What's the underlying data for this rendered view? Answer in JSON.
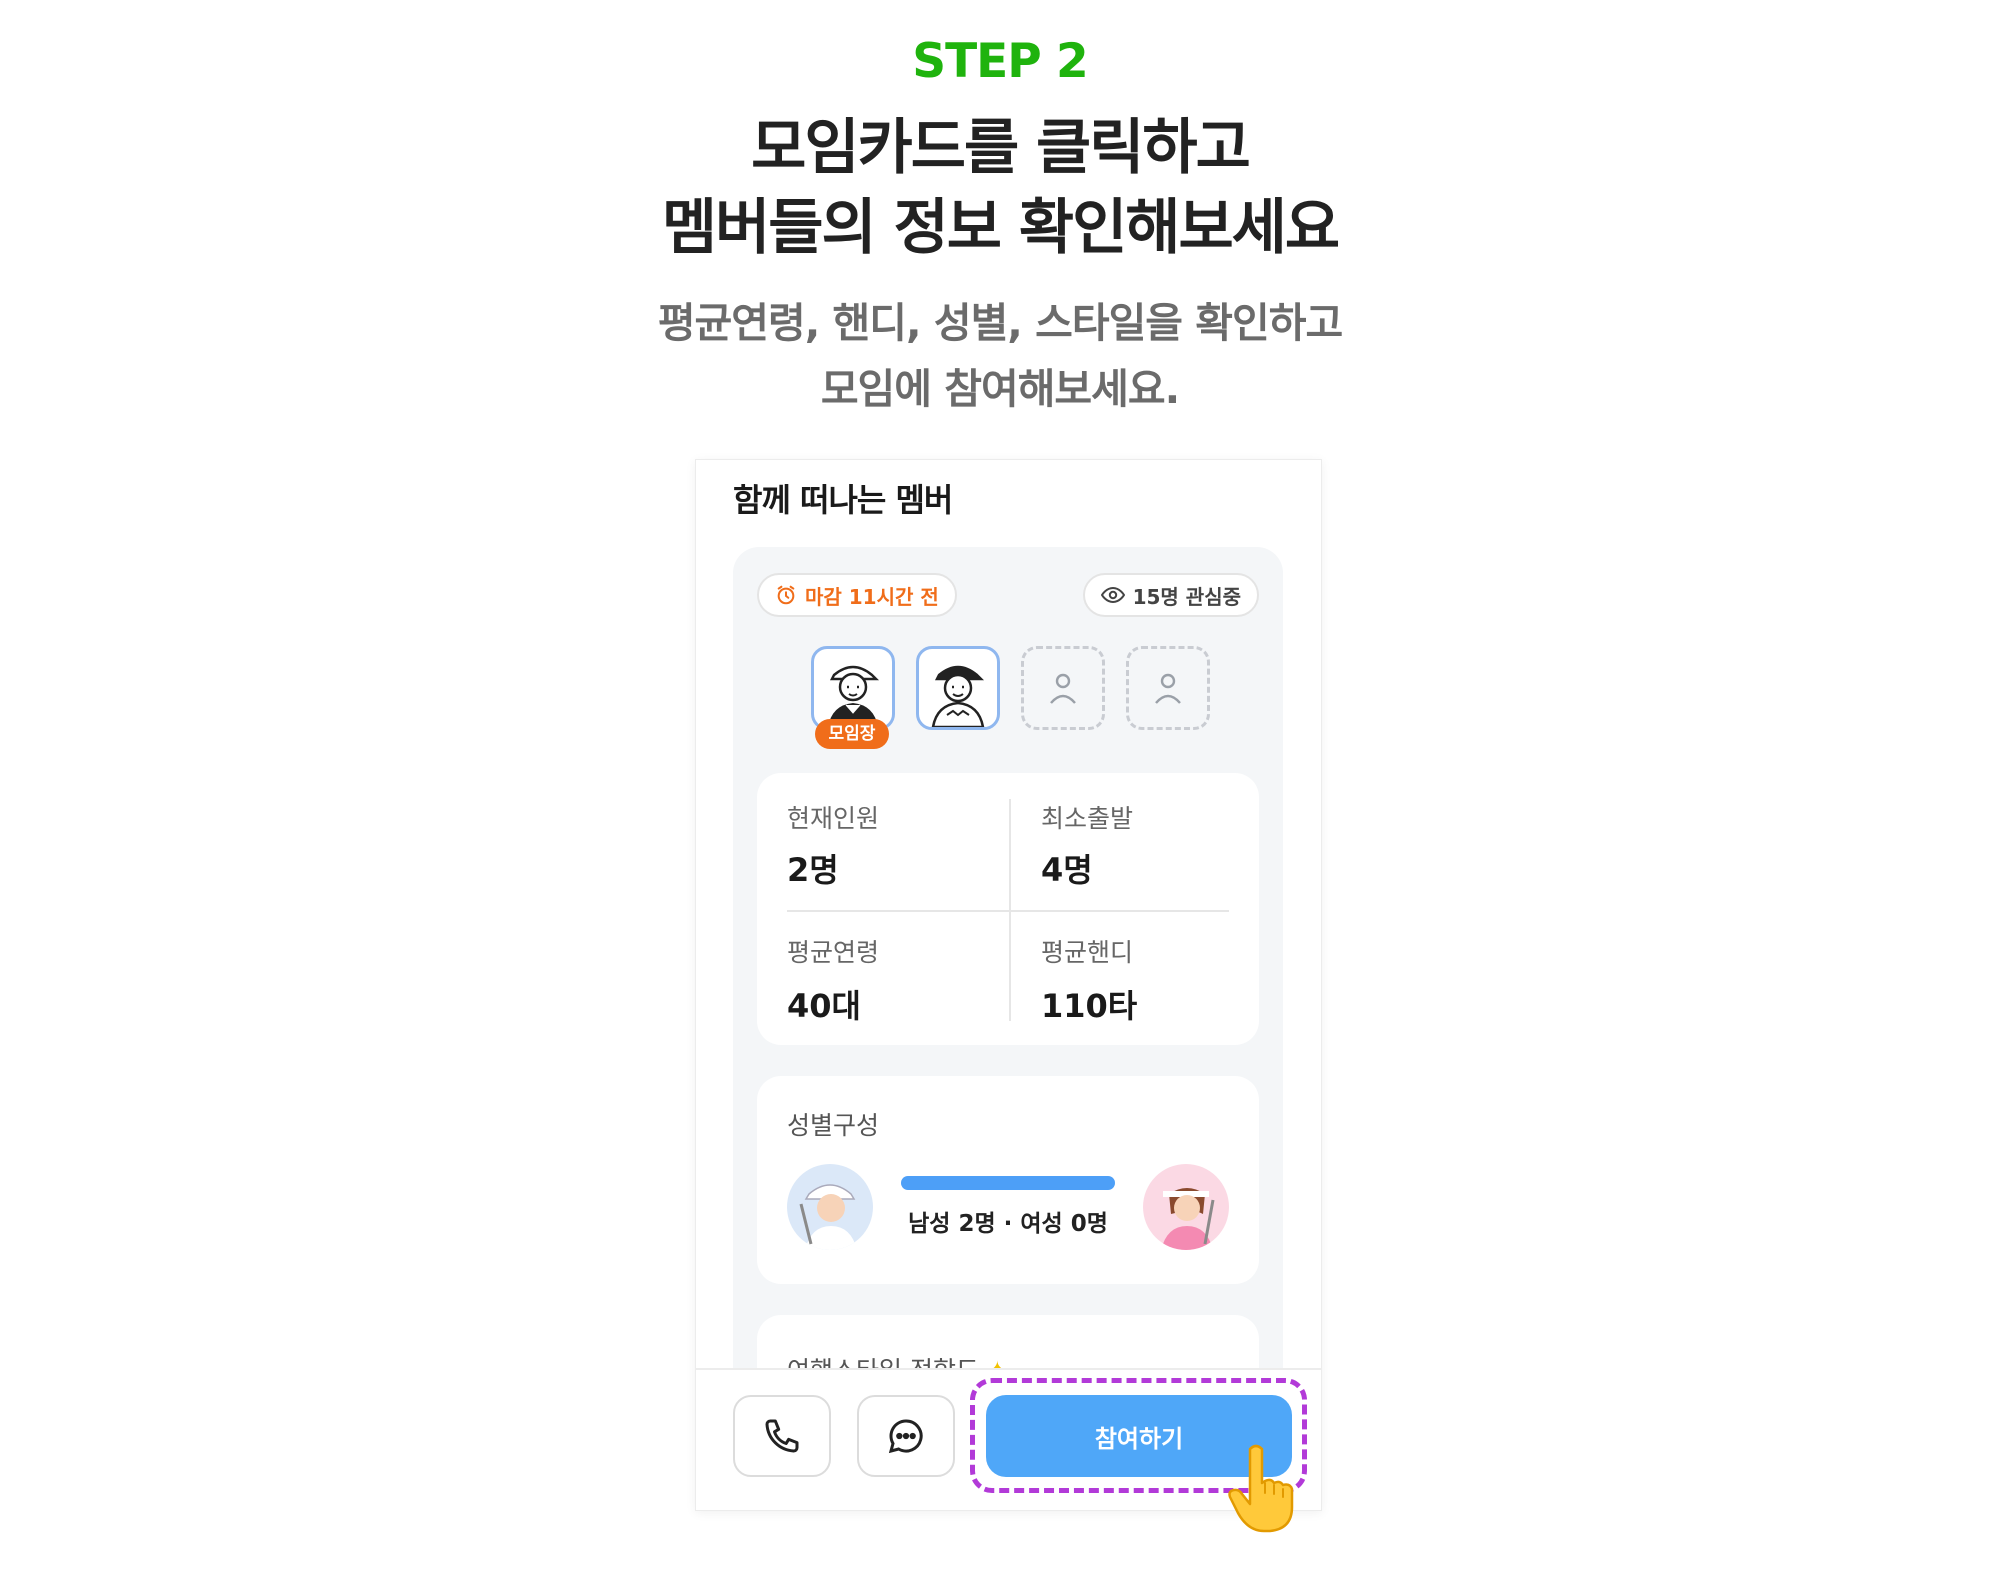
{
  "header": {
    "step": "STEP 2",
    "title_line1": "모임카드를 클릭하고",
    "title_line2": "멤버들의 정보 확인해보세요",
    "desc_line1": "평균연령, 핸디, 성별, 스타일을 확인하고",
    "desc_line2": "모임에 참여해보세요."
  },
  "screen": {
    "section_title": "함께 떠나는 멤버",
    "deadline": "마감 11시간 전",
    "views": "15명 관심중",
    "leader_badge": "모임장",
    "stats": {
      "current_label": "현재인원",
      "current_value": "2명",
      "min_label": "최소출발",
      "min_value": "4명",
      "age_label": "평균연령",
      "age_value": "40대",
      "handi_label": "평균핸디",
      "handi_value": "110타"
    },
    "gender": {
      "title": "성별구성",
      "summary": "남성 2명 · 여성 0명",
      "male_ratio": 1.0
    },
    "style_title": "여행스타일 적합도",
    "join_button": "참여하기"
  },
  "colors": {
    "step_green": "#1fb30d",
    "accent_orange": "#f06d1a",
    "button_blue": "#4fa7f8",
    "highlight_purple": "#b23ad8"
  },
  "icons": [
    "alarm-clock-icon",
    "eye-icon",
    "person-outline-icon",
    "phone-icon",
    "chat-bubble-icon",
    "pointing-hand-icon",
    "sparkle-icon"
  ]
}
